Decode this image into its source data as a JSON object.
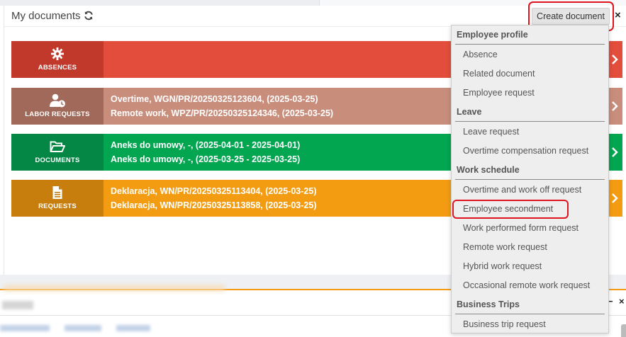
{
  "widget": {
    "title": "My documents",
    "create_button": "Create document",
    "close_label": "×"
  },
  "cards": [
    {
      "label": "ABSENCES",
      "icon": "gear-icon",
      "lines": []
    },
    {
      "label": "LABOR REQUESTS",
      "icon": "user-clock-icon",
      "lines": [
        "Overtime, WGN/PR/20250325123604, (2025-03-25)",
        "Remote work, WPZ/PR/20250325124346, (2025-03-25)"
      ]
    },
    {
      "label": "DOCUMENTS",
      "icon": "folder-open-icon",
      "lines": [
        "Aneks do umowy, -, (2025-04-01 - 2025-04-01)",
        "Aneks do umowy, -, (2025-03-25 - 2025-03-25)"
      ]
    },
    {
      "label": "REQUESTS",
      "icon": "file-icon",
      "lines": [
        "Deklaracja, WN/PR/20250325113404, (2025-03-25)",
        "Deklaracja, WN/PR/20250325113858, (2025-03-25)"
      ]
    }
  ],
  "colors": {
    "absences": "#e34d3c",
    "labor": "#c98d7c",
    "documents": "#02a650",
    "requests": "#f39c12",
    "highlight": "#e0141e"
  },
  "dropdown": {
    "sections": [
      {
        "header": "Employee profile",
        "items": [
          "Absence",
          "Related document",
          "Employee request"
        ]
      },
      {
        "header": "Leave",
        "items": [
          "Leave request",
          "Overtime compensation request"
        ]
      },
      {
        "header": "Work schedule",
        "items": [
          "Overtime and work off request",
          "Employee secondment",
          "Work performed form request",
          "Remote work request",
          "Hybrid work request",
          "Occasional remote work request"
        ]
      },
      {
        "header": "Business Trips",
        "items": [
          "Business trip request"
        ]
      }
    ],
    "highlighted_item": "Employee secondment"
  },
  "lower_widget": {
    "minimize_label": "−",
    "close_label": "×"
  }
}
